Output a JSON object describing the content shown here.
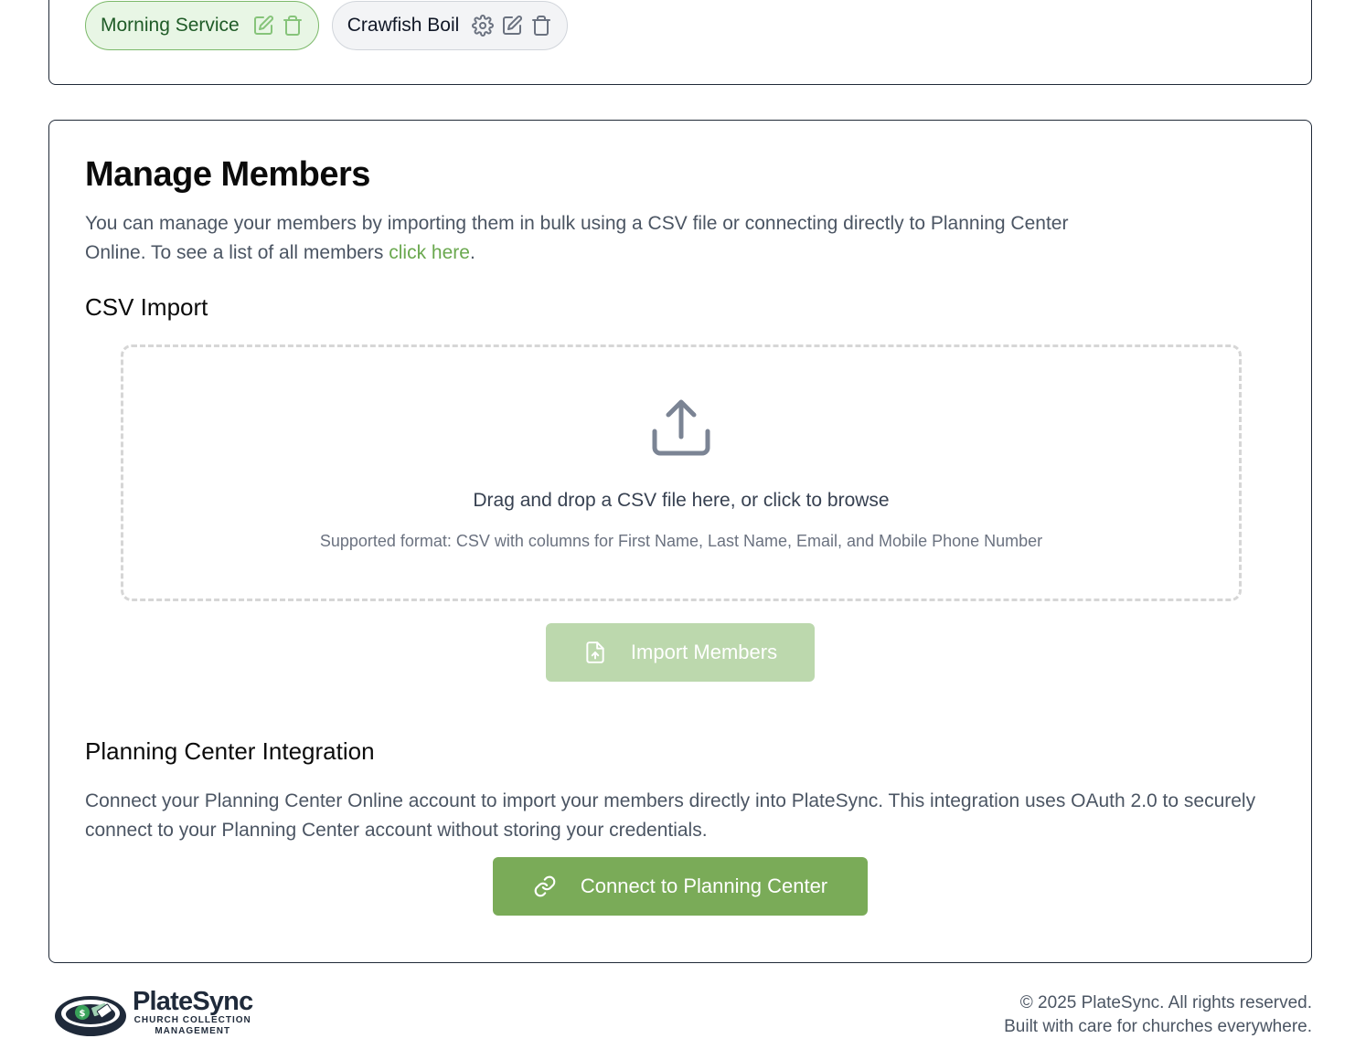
{
  "services": {
    "chips": [
      {
        "label": "Morning Service",
        "active": true,
        "icons": [
          "edit-icon",
          "trash-icon"
        ]
      },
      {
        "label": "Crawfish Boil",
        "active": false,
        "icons": [
          "gear-icon",
          "edit-icon",
          "trash-icon"
        ]
      }
    ]
  },
  "manage": {
    "title": "Manage Members",
    "intro_text": "You can manage your members by importing them in bulk using a CSV file or connecting directly to Planning Center Online. To see a list of all members ",
    "intro_link": "click here",
    "intro_end": "."
  },
  "csv": {
    "heading": "CSV Import",
    "drop_main": "Drag and drop a CSV file here, or click to browse",
    "drop_sub": "Supported format: CSV with columns for First Name, Last Name, Email, and Mobile Phone Number",
    "import_button": "Import Members"
  },
  "planning_center": {
    "heading": "Planning Center Integration",
    "description": "Connect your Planning Center Online account to import your members directly into PlateSync. This integration uses OAuth 2.0 to securely connect to your Planning Center account without storing your credentials.",
    "connect_button": "Connect to Planning Center"
  },
  "footer": {
    "logo_name": "PlateSync",
    "logo_tagline_1": "CHURCH COLLECTION",
    "logo_tagline_2": "MANAGEMENT",
    "copyright": "© 2025 PlateSync. All rights reserved.",
    "tagline": "Built with care for churches everywhere."
  },
  "colors": {
    "accent": "#7aab58",
    "accent_disabled": "#bcd8ad",
    "link": "#6aa84f",
    "chip_active_bg": "#e8f6e5"
  }
}
